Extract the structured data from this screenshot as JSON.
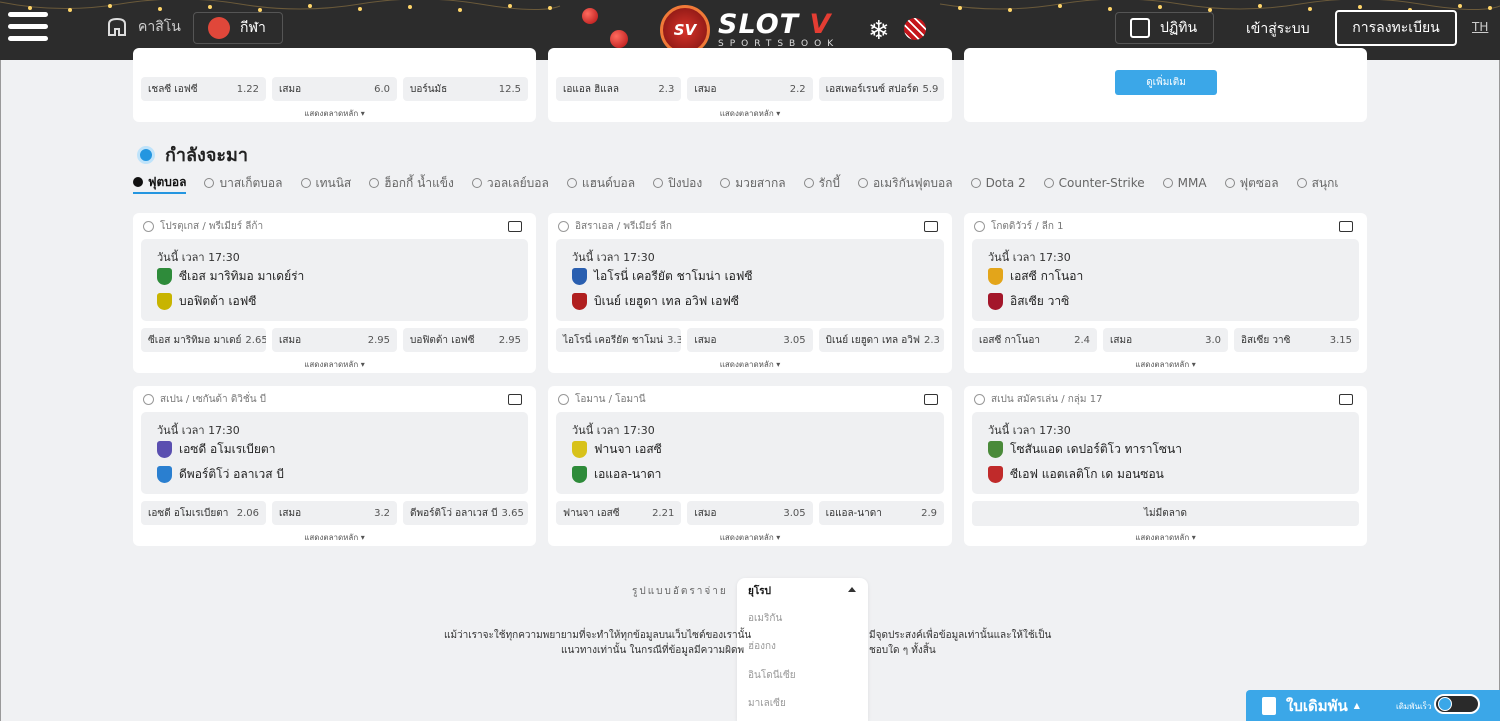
{
  "header": {
    "casino_label": "คาสิโน",
    "sport_label": "กีฬา",
    "logo_badge": "SV",
    "logo_main": "SLOT",
    "logo_main_accent": "V",
    "logo_sub": "SPORTSBOOK",
    "calendar_label": "ปฏิทิน",
    "login_label": "เข้าสู่ระบบ",
    "register_label": "การลงทะเบียน",
    "lang": "TH"
  },
  "top_cards": [
    {
      "odds": [
        {
          "name": "เชลซี เอฟซี",
          "value": "1.22"
        },
        {
          "name": "เสมอ",
          "value": "6.0"
        },
        {
          "name": "บอร์นมัธ",
          "value": "12.5"
        }
      ]
    },
    {
      "odds": [
        {
          "name": "เอแอล ฮิแลล",
          "value": "2.3"
        },
        {
          "name": "เสมอ",
          "value": "2.2"
        },
        {
          "name": "เอสเพอร์เรนซ์ สปอร์ต",
          "value": "5.9"
        }
      ]
    }
  ],
  "see_more_label": "ดูเพิ่มเติม",
  "show_main_market": "แสดงตลาดหลัก",
  "section_title": "กำลังจะมา",
  "tabs": [
    "ฟุตบอล",
    "บาสเก็ตบอล",
    "เทนนิส",
    "ฮ็อกกี้ น้ำแข็ง",
    "วอลเลย์บอล",
    "แฮนด์บอล",
    "ปิงปอง",
    "มวยสากล",
    "รักบี้",
    "อเมริกันฟุตบอล",
    "Dota 2",
    "Counter-Strike",
    "MMA",
    "ฟุตซอล",
    "สนุกเ"
  ],
  "matches": [
    {
      "league": "โปรตุเกส / พรีเมียร์ ลีก้า",
      "time": "วันนี้ เวลา 17:30",
      "home": "ซีเอส มาริทิมอ มาเดย์ร่า",
      "away": "บอฟิตต้า เอฟซี",
      "home_color": "#2e8b3a",
      "away_color": "#c8b400",
      "odds": [
        {
          "name": "ซีเอส มาริทิมอ มาเดย์",
          "value": "2.65"
        },
        {
          "name": "เสมอ",
          "value": "2.95"
        },
        {
          "name": "บอฟิตต้า เอฟซี",
          "value": "2.95"
        }
      ]
    },
    {
      "league": "อิสราเอล / พรีเมียร์ ลีก",
      "time": "วันนี้ เวลา 17:30",
      "home": "ไอโรนี่ เคอรียัต ชาโมน่า เอฟซี",
      "away": "บิเนย์ เยฮูดา เทล อวิฟ เอฟซี",
      "home_color": "#2a5fb0",
      "away_color": "#b01f1f",
      "odds": [
        {
          "name": "ไอโรนี่ เคอรียัต ชาโมน่",
          "value": "3.3"
        },
        {
          "name": "เสมอ",
          "value": "3.05"
        },
        {
          "name": "บิเนย์ เยฮูดา เทล อวิฟ",
          "value": "2.3"
        }
      ]
    },
    {
      "league": "โกตดิวัวร์ / ลีก 1",
      "time": "วันนี้ เวลา 17:30",
      "home": "เอสซี กาโนอา",
      "away": "อิสเซีย วาซิ",
      "home_color": "#e3a51a",
      "away_color": "#a3162a",
      "odds": [
        {
          "name": "เอสซี กาโนอา",
          "value": "2.4"
        },
        {
          "name": "เสมอ",
          "value": "3.0"
        },
        {
          "name": "อิสเซีย วาซิ",
          "value": "3.15"
        }
      ]
    },
    {
      "league": "สเปน / เซกันด้า ดิวิชั่น บี",
      "time": "วันนี้ เวลา 17:30",
      "home": "เอซดี อโมเรเบียตา",
      "away": "ดีพอร์ติโว่ อลาเวส บี",
      "home_color": "#5a4fb0",
      "away_color": "#2a7fd0",
      "odds": [
        {
          "name": "เอซดี อโมเรเบียตา",
          "value": "2.06"
        },
        {
          "name": "เสมอ",
          "value": "3.2"
        },
        {
          "name": "ดีพอร์ติโว่ อลาเวส บี",
          "value": "3.65"
        }
      ]
    },
    {
      "league": "โอมาน / โอมานี",
      "time": "วันนี้ เวลา 17:30",
      "home": "ฟานจา เอสซี",
      "away": "เอแอล-นาดา",
      "home_color": "#d8c21a",
      "away_color": "#2e8b3a",
      "odds": [
        {
          "name": "ฟานจา เอสซี",
          "value": "2.21"
        },
        {
          "name": "เสมอ",
          "value": "3.05"
        },
        {
          "name": "เอแอล-นาดา",
          "value": "2.9"
        }
      ]
    },
    {
      "league": "สเปน สมัครเล่น / กลุ่ม 17",
      "time": "วันนี้ เวลา 17:30",
      "home": "โซสันแอด เดปอร์ติโว ทาราโซนา",
      "away": "ซีเอฟ แอตเลติโก เด มอนซอน",
      "home_color": "#4a8a3a",
      "away_color": "#c02a2a",
      "no_market": "ไม่มีตลาด"
    }
  ],
  "odds_format": {
    "label": "รูปแบบอัตราจ่าย",
    "selected": "ยุโรป",
    "options": [
      "อเมริกัน",
      "ฮ่องกง",
      "อินโดนีเซีย",
      "มาเลเซีย"
    ]
  },
  "disclaimer": {
    "line1_left": "แม้ว่าเราจะใช้ทุกความพยายามที่จะทำให้ทุกข้อมูลบนเว็บไซต์ของเรานั้น",
    "line1_right": "มีจุดประสงค์เพื่อข้อมูลเท่านั้นและให้ใช้เป็น",
    "line2_left": "แนวทางเท่านั้น ในกรณีที่ข้อมูลมีความผิดพ",
    "line2_right": "ชอบใด ๆ ทั้งสิ้น"
  },
  "betslip": {
    "title": "ใบเดิมพัน",
    "quick_bet": "เดิมพันเร็ว"
  },
  "colors": {
    "accent": "#3ba7e8",
    "header_bg": "#2c2c2c",
    "brand_red": "#e43d33"
  }
}
